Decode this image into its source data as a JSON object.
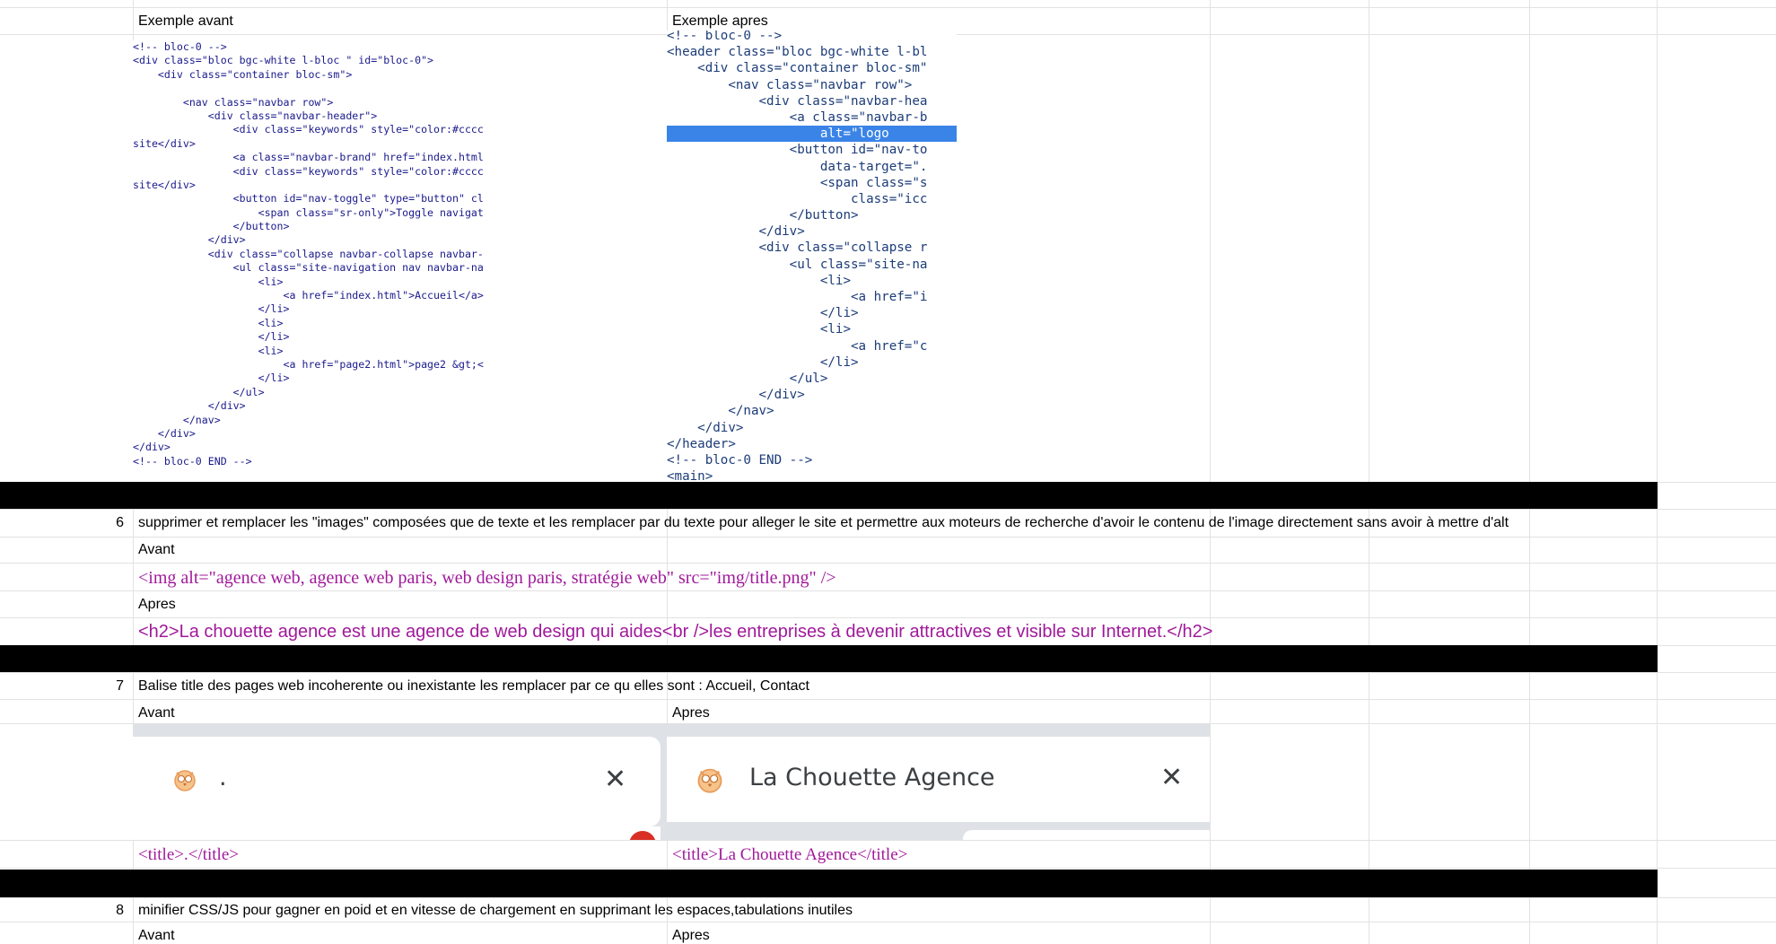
{
  "section5": {
    "header_left": "Exemple avant",
    "header_right": "Exemple apres",
    "code_before": [
      "<!-- bloc-0 -->",
      "<div class=\"bloc bgc-white l-bloc \" id=\"bloc-0\">",
      "    <div class=\"container bloc-sm\">",
      "",
      "        <nav class=\"navbar row\">",
      "            <div class=\"navbar-header\">",
      "                <div class=\"keywords\" style=\"color:#cccc",
      "site</div>",
      "                <a class=\"navbar-brand\" href=\"index.html",
      "                <div class=\"keywords\" style=\"color:#cccc",
      "site</div>",
      "                <button id=\"nav-toggle\" type=\"button\" cl",
      "                    <span class=\"sr-only\">Toggle navigat",
      "                </button>",
      "            </div>",
      "            <div class=\"collapse navbar-collapse navbar-",
      "                <ul class=\"site-navigation nav navbar-na",
      "                    <li>",
      "                        <a href=\"index.html\">Accueil</a>",
      "                    </li>",
      "                    <li>",
      "                    </li>",
      "                    <li>",
      "                        <a href=\"page2.html\">page2 &gt;<",
      "                    </li>",
      "                </ul>",
      "            </div>",
      "        </nav>",
      "    </div>",
      "</div>",
      "<!-- bloc-0 END -->"
    ],
    "code_after": [
      "<!-- bloc-0 -->",
      "<header class=\"bloc bgc-white l-bl",
      "    <div class=\"container bloc-sm\"",
      "        <nav class=\"navbar row\">",
      "            <div class=\"navbar-hea",
      "                <a class=\"navbar-b",
      "                    alt=\"logo",
      "                <button id=\"nav-to",
      "                    data-target=\".",
      "                    <span class=\"s",
      "                        class=\"icc",
      "                </button>",
      "            </div>",
      "            <div class=\"collapse r",
      "                <ul class=\"site-na",
      "                    <li>",
      "                        <a href=\"i",
      "                    </li>",
      "                    <li>",
      "                        <a href=\"c",
      "                    </li>",
      "                </ul>",
      "            </div>",
      "        </nav>",
      "    </div>",
      "</header>",
      "<!-- bloc-0 END -->",
      "<main>"
    ]
  },
  "section6": {
    "number": "6",
    "description": "supprimer et remplacer les \"images\" composées que de texte et les remplacer par du texte pour alleger le site et permettre aux moteurs de recherche d'avoir le contenu de l'image directement sans avoir à mettre d'alt",
    "before_label": "Avant",
    "before_code": "<img alt=\"agence web, agence web paris, web design paris, stratégie web\" src=\"img/title.png\" />",
    "after_label": "Apres",
    "after_code": "<h2>La chouette agence est une agence de web design qui aides<br />les entreprises à devenir attractives et visible sur Internet.</h2>"
  },
  "section7": {
    "number": "7",
    "description": "Balise title des pages web incoherente ou inexistante les remplacer par ce qu elles sont : Accueil, Contact",
    "before_label": "Avant",
    "after_label": "Apres",
    "tab_before_title": ".",
    "tab_after_title": "La Chouette Agence",
    "before_code": "<title>.</title>",
    "after_code": "<title>La Chouette Agence</title>"
  },
  "section8": {
    "number": "8",
    "description": "minifier CSS/JS pour gagner en poid et en vitesse de chargement en supprimant les espaces,tabulations inutiles",
    "before_label": "Avant",
    "after_label": "Apres"
  },
  "icons": {
    "tab_favicon": "owl-icon",
    "tab_close": "close-icon"
  },
  "colors": {
    "code_purple": "#a0199a",
    "selection_blue": "#3a84e8",
    "band": "#000000"
  }
}
